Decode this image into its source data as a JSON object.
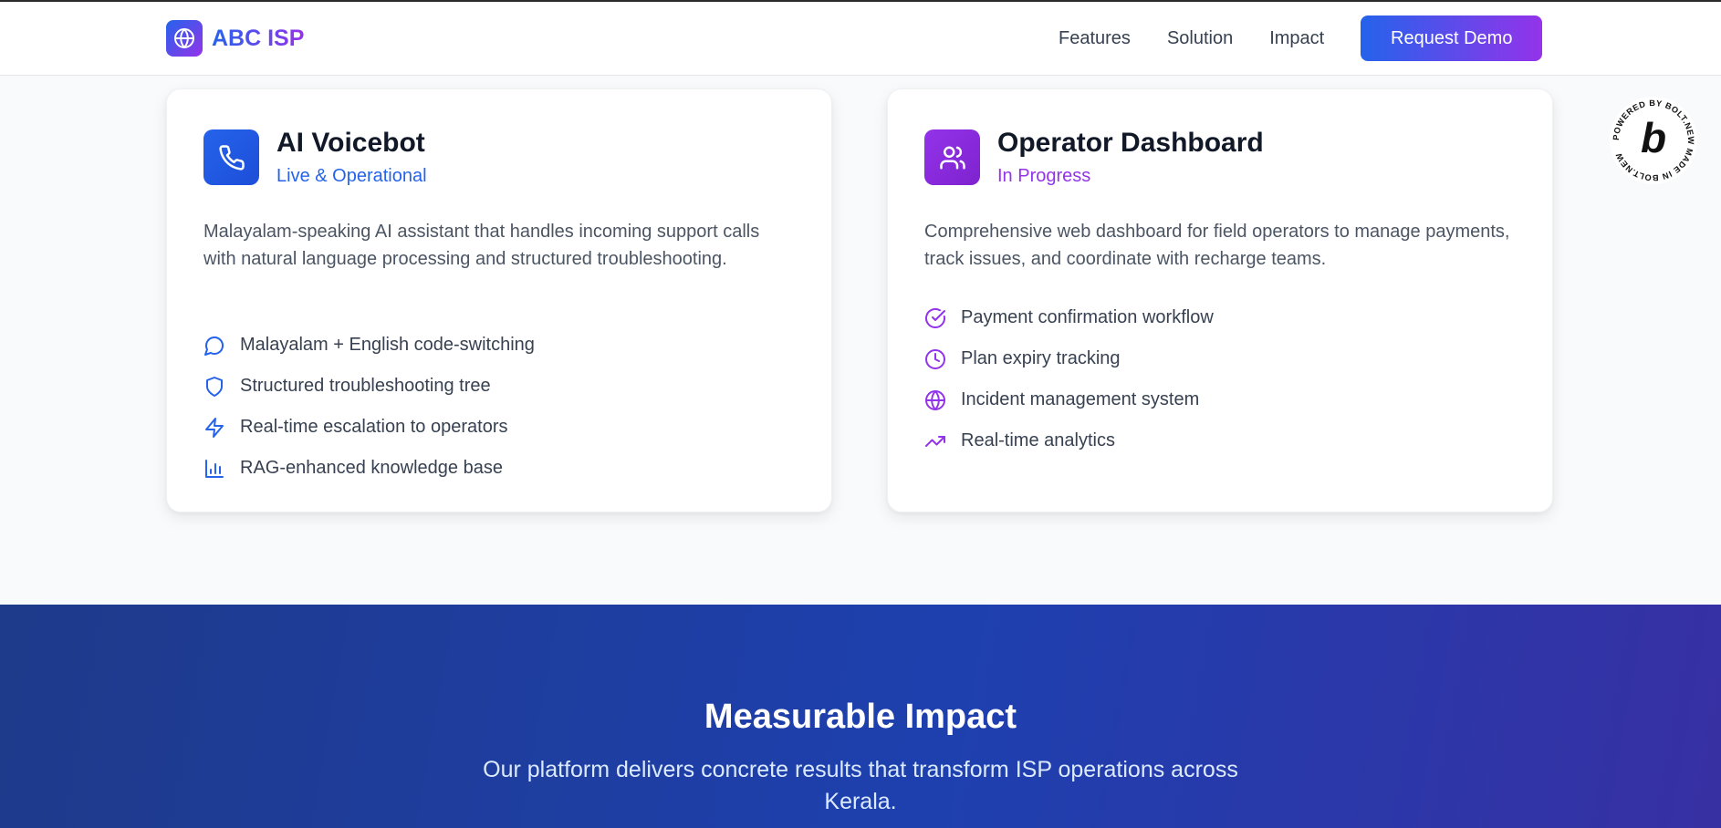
{
  "header": {
    "logo_text": "ABC ISP",
    "nav": [
      "Features",
      "Solution",
      "Impact"
    ],
    "cta_label": "Request Demo"
  },
  "cards": [
    {
      "title": "AI Voicebot",
      "status": "Live & Operational",
      "description": "Malayalam-speaking AI assistant that handles incoming support calls with natural language processing and structured troubleshooting.",
      "icon": "phone-icon",
      "accent": "#2563eb",
      "features": [
        {
          "icon": "chat-bubble-icon",
          "label": "Malayalam + English code-switching"
        },
        {
          "icon": "shield-icon",
          "label": "Structured troubleshooting tree"
        },
        {
          "icon": "lightning-icon",
          "label": "Real-time escalation to operators"
        },
        {
          "icon": "bar-chart-icon",
          "label": "RAG-enhanced knowledge base"
        }
      ]
    },
    {
      "title": "Operator Dashboard",
      "status": "In Progress",
      "description": "Comprehensive web dashboard for field operators to manage payments, track issues, and coordinate with recharge teams.",
      "icon": "users-icon",
      "accent": "#9333ea",
      "features": [
        {
          "icon": "check-circle-icon",
          "label": "Payment confirmation workflow"
        },
        {
          "icon": "clock-icon",
          "label": "Plan expiry tracking"
        },
        {
          "icon": "globe-icon",
          "label": "Incident management system"
        },
        {
          "icon": "trending-up-icon",
          "label": "Real-time analytics"
        }
      ]
    }
  ],
  "badge": {
    "text": "POWERED BY BOLT.NEW MADE IN BOLT.NEW",
    "letter": "b"
  },
  "impact": {
    "title": "Measurable Impact",
    "subtitle_line1": "Our platform delivers concrete results that transform ISP operations across",
    "subtitle_line2": "Kerala."
  },
  "colors": {
    "primary": "#2563eb",
    "secondary": "#9333ea",
    "impact_bg": "#1e40af"
  }
}
